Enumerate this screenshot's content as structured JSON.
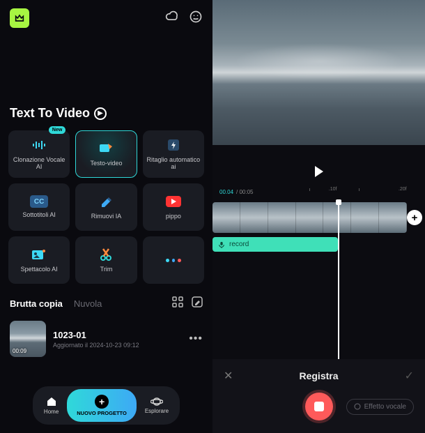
{
  "hero": {
    "title": "Text To Video"
  },
  "features": [
    {
      "label": "Clonazione Vocale AI",
      "badge": "New"
    },
    {
      "label": "Testo-video"
    },
    {
      "label": "Ritaglio automatico ai"
    },
    {
      "label": "Sottotitoli AI"
    },
    {
      "label": "Rimuovi IA"
    },
    {
      "label": "pippo"
    },
    {
      "label": "Spettacolo AI"
    },
    {
      "label": "Trim"
    },
    {
      "label": ""
    }
  ],
  "tabs": {
    "draft": "Brutta copia",
    "cloud": "Nuvola"
  },
  "project": {
    "title": "1023-01",
    "subtitle": "Aggiornato il 2024-10-23 09:12",
    "duration": "00:09"
  },
  "nav": {
    "home": "Home",
    "new": "NUOVO PROGETTO",
    "explore": "Esplorare"
  },
  "timeline": {
    "current": "00.04",
    "total": "00:05",
    "tick1": ".10f",
    "tick2": ".20f"
  },
  "audio": {
    "label": "record"
  },
  "record": {
    "title": "Registra",
    "voiceEffect": "Effetto vocale"
  },
  "colors": {
    "accent": "#2fd9d9",
    "mint": "#3fe0b8",
    "red": "#ff5a5a",
    "lime": "#a7f542"
  }
}
